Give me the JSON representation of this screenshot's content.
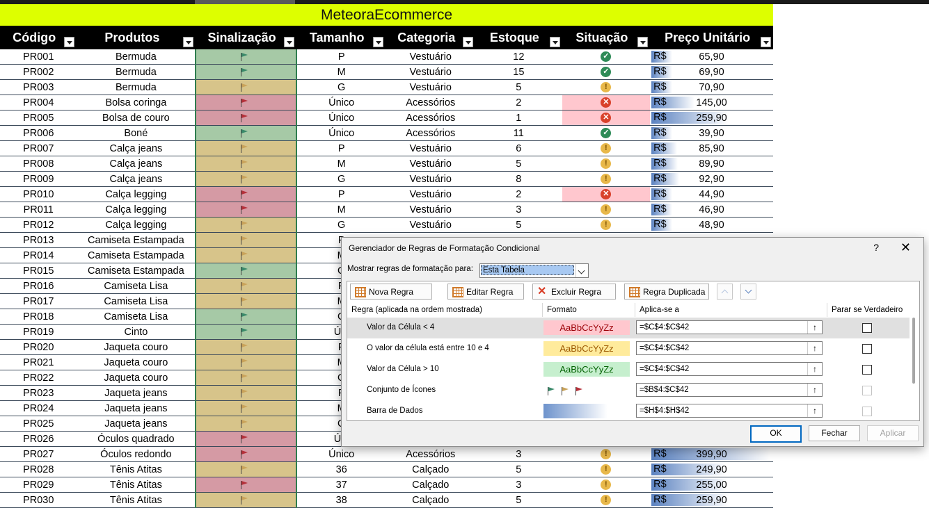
{
  "sheet": {
    "title": "MeteoraEcommerce",
    "headers": [
      "Código",
      "Produtos",
      "Sinalização",
      "Tamanho",
      "Categoria",
      "Estoque",
      "Situação",
      "Preço Unitário"
    ],
    "colors": {
      "green_fill": "#a6c9a6",
      "yellow_fill": "#d7c48a",
      "red_fill": "#d59aa4",
      "title_bg": "#ddff00",
      "flag_green": "#3a8a6a",
      "flag_yellow": "#c9a35a",
      "flag_red": "#b5303a"
    },
    "currency": "R$",
    "rows": [
      {
        "code": "PR001",
        "product": "Bermuda",
        "flag": "green",
        "size": "P",
        "category": "Vestuário",
        "stock": "12",
        "status": "ok",
        "price": "65,90",
        "pv": 65.9
      },
      {
        "code": "PR002",
        "product": "Bermuda",
        "flag": "green",
        "size": "M",
        "category": "Vestuário",
        "stock": "15",
        "status": "ok",
        "price": "69,90",
        "pv": 69.9
      },
      {
        "code": "PR003",
        "product": "Bermuda",
        "flag": "yellow",
        "size": "G",
        "category": "Vestuário",
        "stock": "5",
        "status": "warn",
        "price": "70,90",
        "pv": 70.9
      },
      {
        "code": "PR004",
        "product": "Bolsa coringa",
        "flag": "red",
        "size": "Único",
        "category": "Acessórios",
        "stock": "2",
        "status": "bad",
        "price": "145,00",
        "pv": 145.0
      },
      {
        "code": "PR005",
        "product": "Bolsa de couro",
        "flag": "red",
        "size": "Único",
        "category": "Acessórios",
        "stock": "1",
        "status": "bad",
        "price": "259,90",
        "pv": 259.9
      },
      {
        "code": "PR006",
        "product": "Boné",
        "flag": "green",
        "size": "Único",
        "category": "Acessórios",
        "stock": "11",
        "status": "ok",
        "price": "39,90",
        "pv": 39.9
      },
      {
        "code": "PR007",
        "product": "Calça jeans",
        "flag": "yellow",
        "size": "P",
        "category": "Vestuário",
        "stock": "6",
        "status": "warn",
        "price": "85,90",
        "pv": 85.9
      },
      {
        "code": "PR008",
        "product": "Calça jeans",
        "flag": "yellow",
        "size": "M",
        "category": "Vestuário",
        "stock": "5",
        "status": "warn",
        "price": "89,90",
        "pv": 89.9
      },
      {
        "code": "PR009",
        "product": "Calça jeans",
        "flag": "yellow",
        "size": "G",
        "category": "Vestuário",
        "stock": "8",
        "status": "warn",
        "price": "92,90",
        "pv": 92.9
      },
      {
        "code": "PR010",
        "product": "Calça legging",
        "flag": "red",
        "size": "P",
        "category": "Vestuário",
        "stock": "2",
        "status": "bad",
        "price": "44,90",
        "pv": 44.9
      },
      {
        "code": "PR011",
        "product": "Calça legging",
        "flag": "red",
        "size": "M",
        "category": "Vestuário",
        "stock": "3",
        "status": "warn",
        "price": "46,90",
        "pv": 46.9
      },
      {
        "code": "PR012",
        "product": "Calça legging",
        "flag": "yellow",
        "size": "G",
        "category": "Vestuário",
        "stock": "5",
        "status": "warn",
        "price": "48,90",
        "pv": 48.9
      },
      {
        "code": "PR013",
        "product": "Camiseta Estampada",
        "flag": "yellow",
        "size": "P",
        "category": "",
        "stock": "",
        "status": "",
        "price": "",
        "pv": null
      },
      {
        "code": "PR014",
        "product": "Camiseta Estampada",
        "flag": "yellow",
        "size": "M",
        "category": "",
        "stock": "",
        "status": "",
        "price": "",
        "pv": null
      },
      {
        "code": "PR015",
        "product": "Camiseta Estampada",
        "flag": "green",
        "size": "G",
        "category": "",
        "stock": "",
        "status": "",
        "price": "",
        "pv": null
      },
      {
        "code": "PR016",
        "product": "Camiseta Lisa",
        "flag": "yellow",
        "size": "P",
        "category": "",
        "stock": "",
        "status": "",
        "price": "",
        "pv": null
      },
      {
        "code": "PR017",
        "product": "Camiseta Lisa",
        "flag": "yellow",
        "size": "M",
        "category": "",
        "stock": "",
        "status": "",
        "price": "",
        "pv": null
      },
      {
        "code": "PR018",
        "product": "Camiseta Lisa",
        "flag": "green",
        "size": "G",
        "category": "",
        "stock": "",
        "status": "",
        "price": "",
        "pv": null
      },
      {
        "code": "PR019",
        "product": "Cinto",
        "flag": "green",
        "size": "Úni",
        "category": "",
        "stock": "",
        "status": "",
        "price": "",
        "pv": null
      },
      {
        "code": "PR020",
        "product": "Jaqueta couro",
        "flag": "yellow",
        "size": "P",
        "category": "",
        "stock": "",
        "status": "",
        "price": "",
        "pv": null
      },
      {
        "code": "PR021",
        "product": "Jaqueta couro",
        "flag": "yellow",
        "size": "M",
        "category": "",
        "stock": "",
        "status": "",
        "price": "",
        "pv": null
      },
      {
        "code": "PR022",
        "product": "Jaqueta couro",
        "flag": "yellow",
        "size": "G",
        "category": "",
        "stock": "",
        "status": "",
        "price": "",
        "pv": null
      },
      {
        "code": "PR023",
        "product": "Jaqueta jeans",
        "flag": "yellow",
        "size": "P",
        "category": "",
        "stock": "",
        "status": "",
        "price": "",
        "pv": null
      },
      {
        "code": "PR024",
        "product": "Jaqueta jeans",
        "flag": "yellow",
        "size": "M",
        "category": "",
        "stock": "",
        "status": "",
        "price": "",
        "pv": null
      },
      {
        "code": "PR025",
        "product": "Jaqueta jeans",
        "flag": "yellow",
        "size": "G",
        "category": "",
        "stock": "",
        "status": "",
        "price": "",
        "pv": null
      },
      {
        "code": "PR026",
        "product": "Óculos quadrado",
        "flag": "red",
        "size": "Úni",
        "category": "",
        "stock": "",
        "status": "",
        "price": "",
        "pv": null
      },
      {
        "code": "PR027",
        "product": "Óculos redondo",
        "flag": "red",
        "size": "Único",
        "category": "Acessórios",
        "stock": "3",
        "status": "warn",
        "price": "399,90",
        "pv": 399.9
      },
      {
        "code": "PR028",
        "product": "Tênis Atitas",
        "flag": "yellow",
        "size": "36",
        "category": "Calçado",
        "stock": "5",
        "status": "warn",
        "price": "249,90",
        "pv": 249.9
      },
      {
        "code": "PR029",
        "product": "Tênis Atitas",
        "flag": "red",
        "size": "37",
        "category": "Calçado",
        "stock": "3",
        "status": "warn",
        "price": "255,00",
        "pv": 255.0
      },
      {
        "code": "PR030",
        "product": "Tênis Atitas",
        "flag": "yellow",
        "size": "38",
        "category": "Calçado",
        "stock": "5",
        "status": "warn",
        "price": "259,90",
        "pv": 259.9
      }
    ]
  },
  "dialog": {
    "title": "Gerenciador de Regras de Formatação Condicional",
    "help": "?",
    "close": "✕",
    "show_label": "Mostrar regras de formatação para:",
    "show_value": "Esta Tabela",
    "toolbar": {
      "new": "Nova Regra",
      "edit": "Editar Regra",
      "delete": "Excluir Regra",
      "duplicate": "Regra Duplicada"
    },
    "columns": {
      "rule": "Regra (aplicada na ordem mostrada)",
      "format": "Formato",
      "applies": "Aplica-se a",
      "stop": "Parar se Verdadeiro"
    },
    "rules": [
      {
        "desc": "Valor da Célula < 4",
        "format_text": "AaBbCcYyZz",
        "format_kind": "red",
        "applies": "=$C$4:$C$42",
        "stop_enabled": true
      },
      {
        "desc": "O valor da célula está entre 10 e 4",
        "format_text": "AaBbCcYyZz",
        "format_kind": "yellow",
        "applies": "=$C$4:$C$42",
        "stop_enabled": true
      },
      {
        "desc": "Valor da Célula > 10",
        "format_text": "AaBbCcYyZz",
        "format_kind": "green",
        "applies": "=$C$4:$C$42",
        "stop_enabled": true
      },
      {
        "desc": "Conjunto de Ícones",
        "format_text": "",
        "format_kind": "icons",
        "applies": "=$B$4:$C$42",
        "stop_enabled": false
      },
      {
        "desc": "Barra de Dados",
        "format_text": "",
        "format_kind": "databar",
        "applies": "=$H$4:$H$42",
        "stop_enabled": false
      }
    ],
    "format_colors": {
      "red": {
        "bg": "#ffc7ce",
        "fg": "#9c0006"
      },
      "yellow": {
        "bg": "#ffeb9c",
        "fg": "#9c5700"
      },
      "green": {
        "bg": "#c6efce",
        "fg": "#006100"
      }
    },
    "buttons": {
      "ok": "OK",
      "close": "Fechar",
      "apply": "Aplicar"
    }
  }
}
